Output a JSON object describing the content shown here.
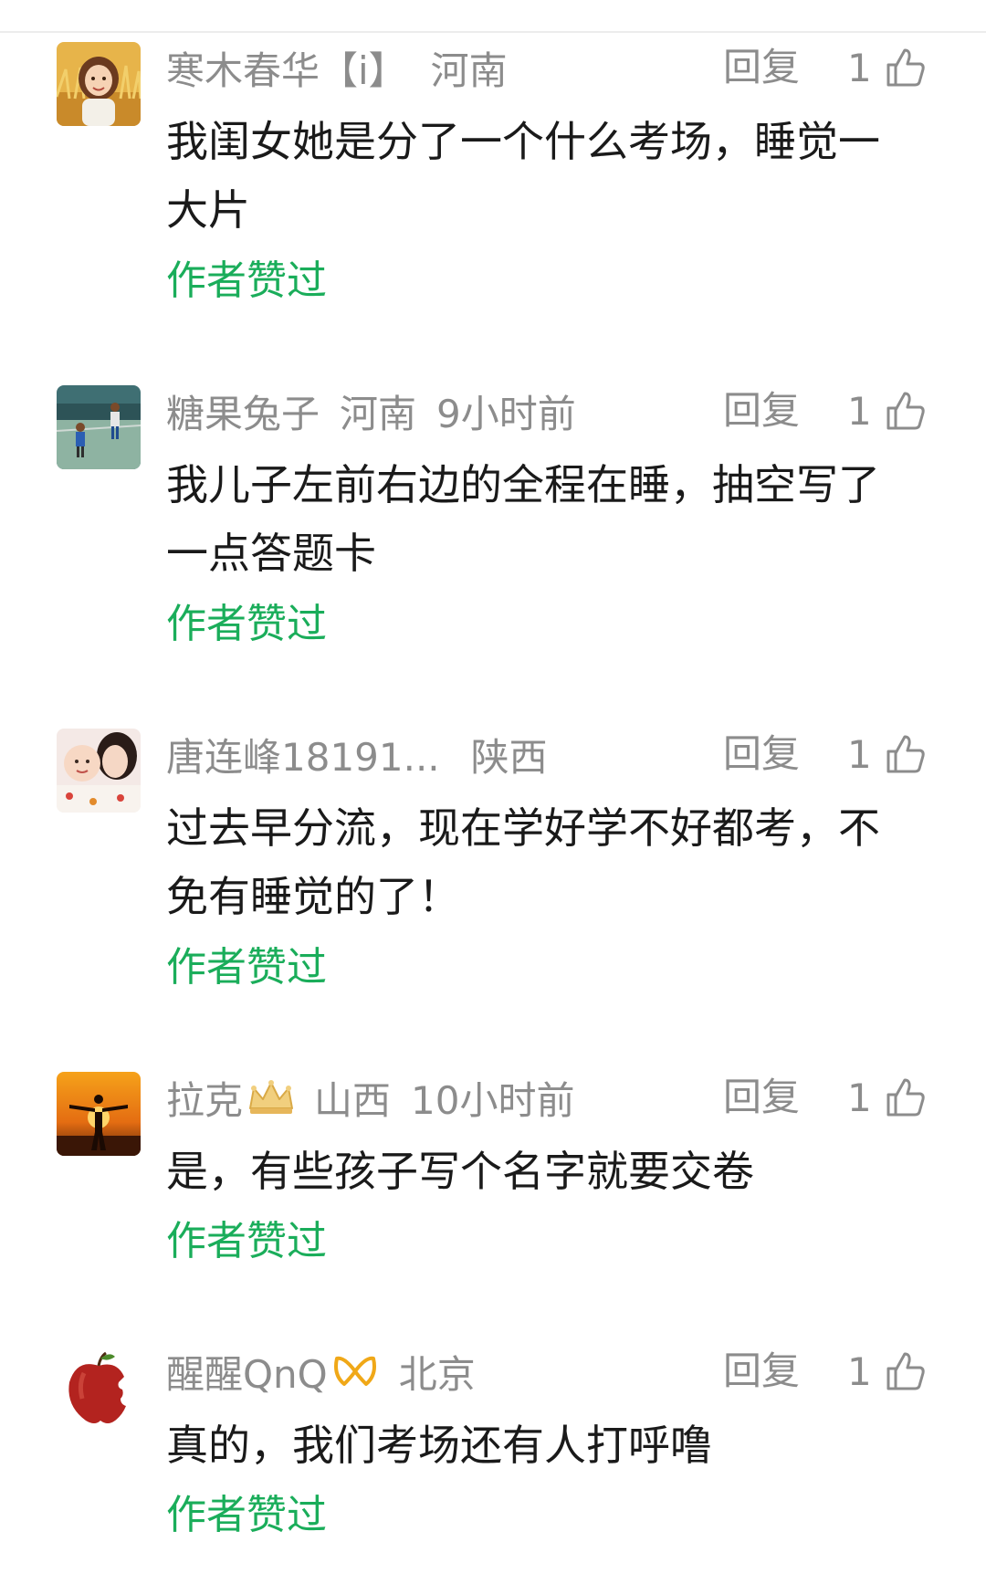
{
  "comments": [
    {
      "username": "寒木春华【i】",
      "location": "河南",
      "time": "",
      "reply_label": "回复",
      "likes": "1",
      "text": "我闺女她是分了一个什么考场，睡觉一大片",
      "author_liked": "作者赞过",
      "avatar_icon": "girl-wheat-field-avatar-icon"
    },
    {
      "username": "糖果兔子",
      "location": "河南",
      "time": "9小时前",
      "reply_label": "回复",
      "likes": "1",
      "text": "我儿子左前右边的全程在睡，抽空写了一点答题卡",
      "author_liked": "作者赞过",
      "avatar_icon": "kids-playing-avatar-icon"
    },
    {
      "username": "唐连峰18191...",
      "location": "陕西",
      "time": "",
      "reply_label": "回复",
      "likes": "1",
      "text": "过去早分流，现在学好学不好都考，不免有睡觉的了！",
      "author_liked": "作者赞过",
      "avatar_icon": "mother-baby-avatar-icon"
    },
    {
      "username": "拉克",
      "location": "山西",
      "time": "10小时前",
      "reply_label": "回复",
      "likes": "1",
      "text": "是，有些孩子写个名字就要交卷",
      "author_liked": "作者赞过",
      "avatar_icon": "sunset-silhouette-avatar-icon",
      "badge_icon": "crown-icon"
    },
    {
      "username": "醒醒QnQ",
      "location": "北京",
      "time": "",
      "reply_label": "回复",
      "likes": "1",
      "text": "真的，我们考场还有人打呼噜",
      "author_liked": "作者赞过",
      "avatar_icon": "bitten-apple-avatar-icon",
      "badge_icon": "ribbon-icon"
    }
  ],
  "colors": {
    "meta_gray": "#8c8c8c",
    "body_text": "#1a1a1a",
    "author_liked_green": "#1aad5a"
  }
}
